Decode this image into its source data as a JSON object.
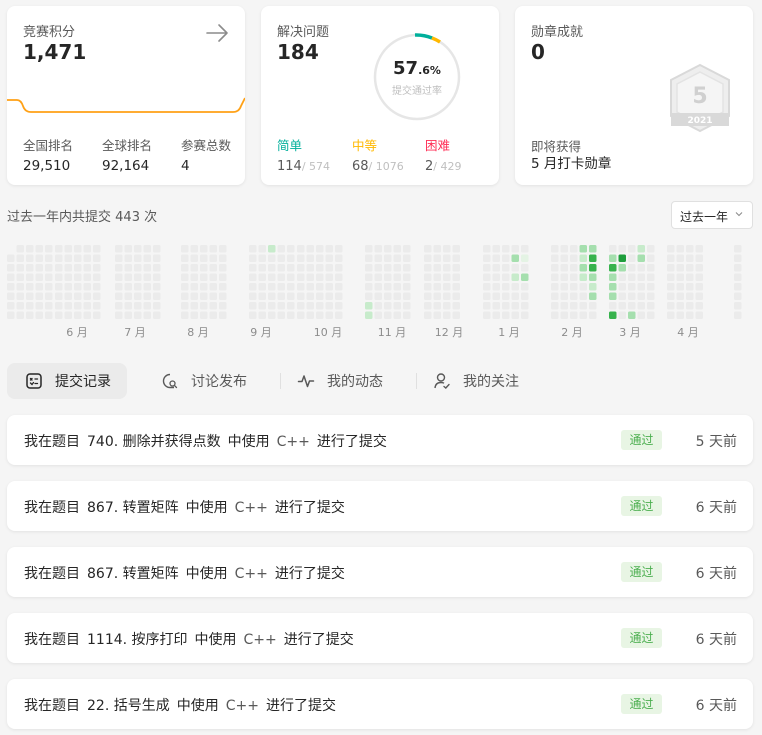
{
  "rating_card": {
    "title": "竞赛积分",
    "value": "1,471",
    "stats": [
      {
        "label": "全国排名",
        "value": "29,510"
      },
      {
        "label": "全球排名",
        "value": "92,164"
      },
      {
        "label": "参赛总数",
        "value": "4"
      }
    ],
    "accent": "#ffa116"
  },
  "solved_card": {
    "title": "解决问题",
    "value": "184",
    "rate_main": "57",
    "rate_decimal": ".6%",
    "rate_label": "提交通过率",
    "difficulties": [
      {
        "label": "简单",
        "solved": "114",
        "total": "/ 574",
        "color": "#00af9b"
      },
      {
        "label": "中等",
        "solved": "68",
        "total": "/ 1076",
        "color": "#ffb800"
      },
      {
        "label": "困难",
        "solved": "2",
        "total": "/ 429",
        "color": "#ff2d55"
      }
    ]
  },
  "badge_card": {
    "title": "勋章成就",
    "value": "0",
    "badge_number": "5",
    "badge_year": "2021",
    "next_label": "即将获得",
    "next_value": "5 月打卡勋章"
  },
  "submissions": {
    "summary_prefix": "过去一年内共提交",
    "count": "443",
    "summary_suffix": "次",
    "range_select": "过去一年",
    "months": [
      "6 月",
      "7 月",
      "8 月",
      "9 月",
      "10 月",
      "11 月",
      "12 月",
      "1 月",
      "2 月",
      "3 月",
      "4 月"
    ]
  },
  "tabs": [
    {
      "label": "提交记录",
      "icon": "submissions-icon",
      "active": true
    },
    {
      "label": "讨论发布",
      "icon": "discussion-icon",
      "active": false
    },
    {
      "label": "我的动态",
      "icon": "activity-icon",
      "active": false
    },
    {
      "label": "我的关注",
      "icon": "following-icon",
      "active": false
    }
  ],
  "records": [
    {
      "prefix": "我在题目",
      "problem": "740. 删除并获得点数",
      "mid": "中使用",
      "lang": "C++",
      "suffix": "进行了提交",
      "status": "通过",
      "time": "5 天前"
    },
    {
      "prefix": "我在题目",
      "problem": "867. 转置矩阵",
      "mid": "中使用",
      "lang": "C++",
      "suffix": "进行了提交",
      "status": "通过",
      "time": "6 天前"
    },
    {
      "prefix": "我在题目",
      "problem": "867. 转置矩阵",
      "mid": "中使用",
      "lang": "C++",
      "suffix": "进行了提交",
      "status": "通过",
      "time": "6 天前"
    },
    {
      "prefix": "我在题目",
      "problem": "1114. 按序打印",
      "mid": "中使用",
      "lang": "C++",
      "suffix": "进行了提交",
      "status": "通过",
      "time": "6 天前"
    },
    {
      "prefix": "我在题目",
      "problem": "22. 括号生成",
      "mid": "中使用",
      "lang": "C++",
      "suffix": "进行了提交",
      "status": "通过",
      "time": "6 天前"
    }
  ]
}
